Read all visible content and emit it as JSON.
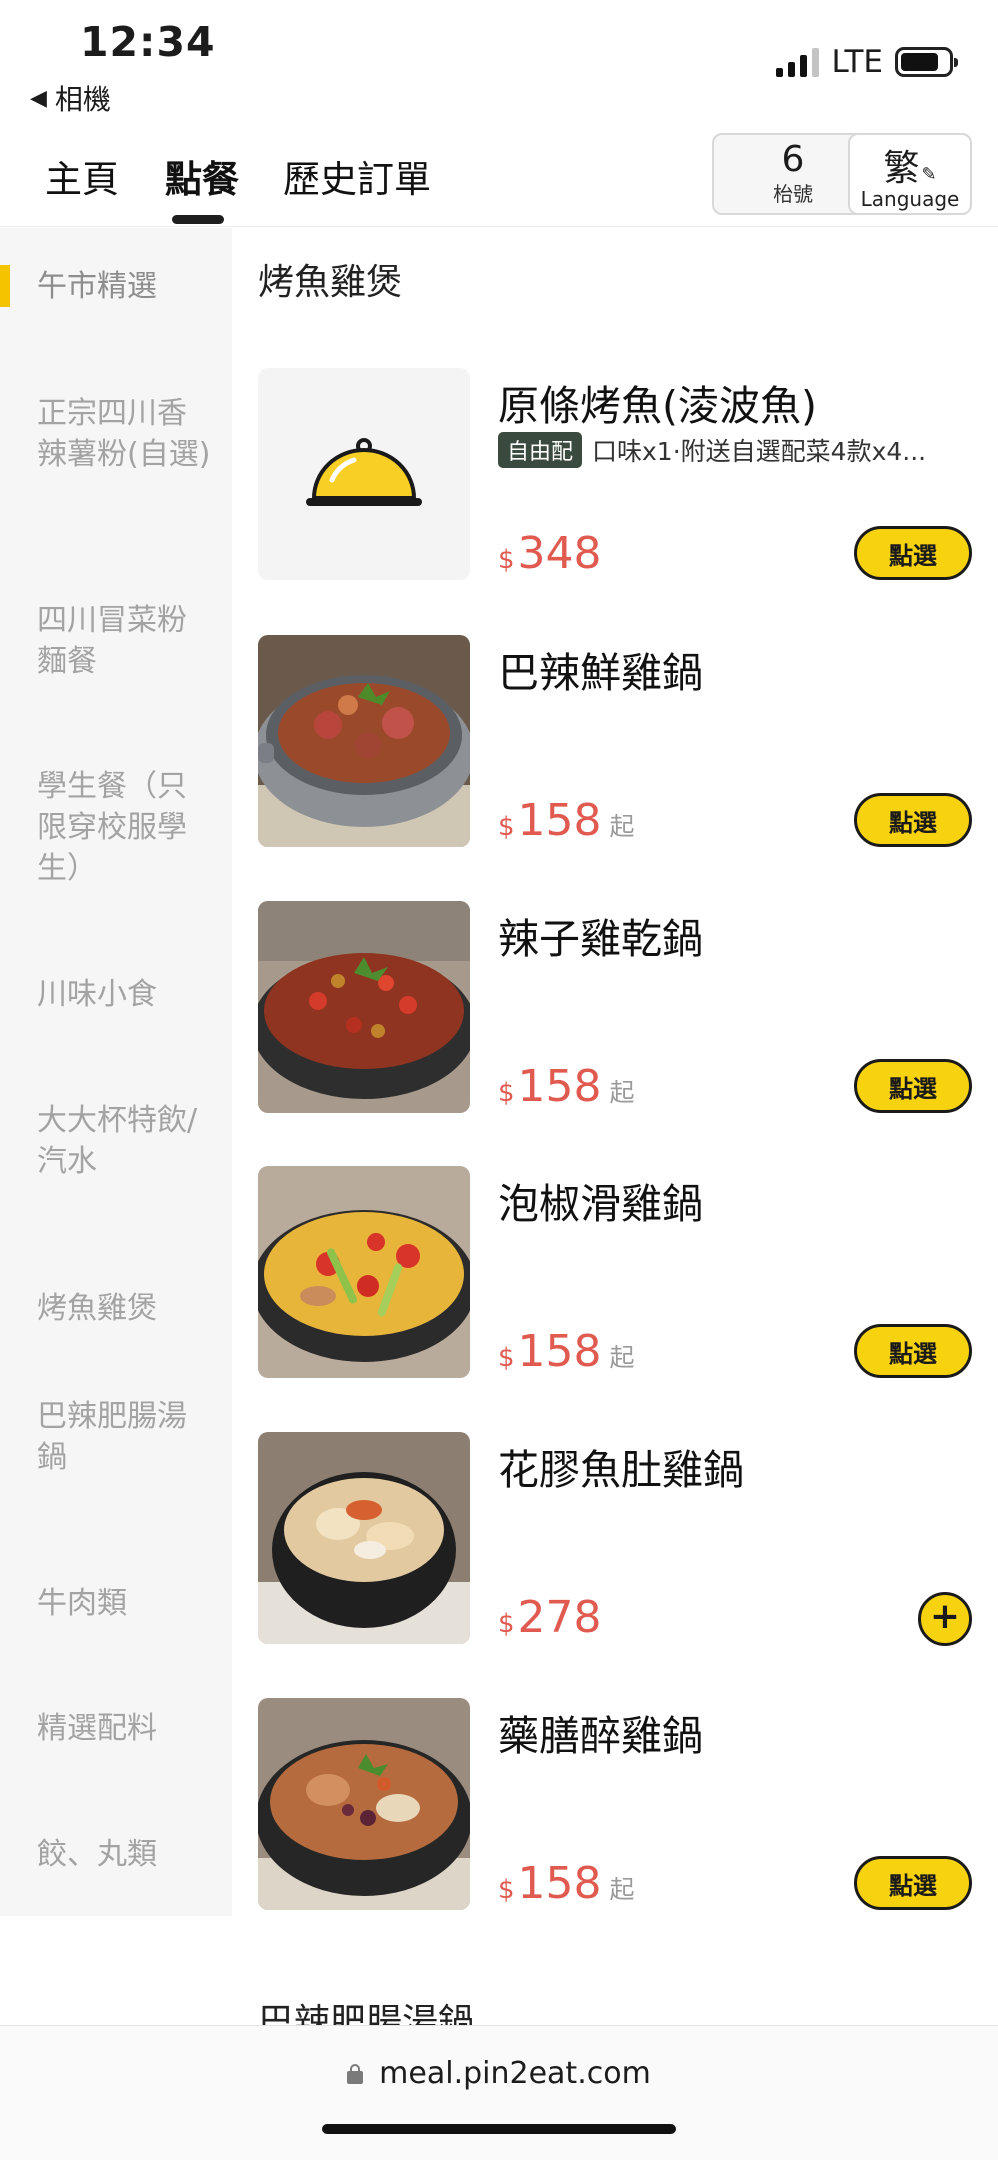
{
  "status_bar": {
    "time": "12:34",
    "back_label": "相機",
    "network": "LTE"
  },
  "nav": {
    "tabs": [
      "主頁",
      "點餐",
      "歷史訂單"
    ],
    "active_tab": "點餐",
    "table_number": "6",
    "table_label": "枱號",
    "language_char": "繁",
    "language_label": "Language"
  },
  "sidebar": {
    "items": [
      {
        "label": "午市精選"
      },
      {
        "label": "正宗四川香辣薯粉(自選)"
      },
      {
        "label": "四川冒菜粉麵餐"
      },
      {
        "label": "學生餐（只限穿校服學生）"
      },
      {
        "label": "川味小食"
      },
      {
        "label": "大大杯特飲/汽水"
      },
      {
        "label": "烤魚雞煲"
      },
      {
        "label": "巴辣肥腸湯鍋"
      },
      {
        "label": "牛肉類"
      },
      {
        "label": "精選配料"
      },
      {
        "label": "餃、丸類"
      }
    ],
    "active_index": 0
  },
  "section": {
    "title": "烤魚雞煲",
    "next_title": "巴辣肥腸湯鍋"
  },
  "menu_items": [
    {
      "name": "原條烤魚(淩波魚)",
      "tag": "自由配",
      "description": "口味x1·附送自選配菜4款x4...",
      "currency": "$",
      "price": "348",
      "suffix": "",
      "button": "點選",
      "image": "placeholder-dish-cover-icon"
    },
    {
      "name": "巴辣鮮雞鍋",
      "currency": "$",
      "price": "158",
      "suffix": "起",
      "button": "點選",
      "image": "spicy-chicken-pot-photo"
    },
    {
      "name": "辣子雞乾鍋",
      "currency": "$",
      "price": "158",
      "suffix": "起",
      "button": "點選",
      "image": "chili-chicken-dry-pot-photo"
    },
    {
      "name": "泡椒滑雞鍋",
      "currency": "$",
      "price": "158",
      "suffix": "起",
      "button": "點選",
      "image": "pickled-pepper-chicken-pot-photo"
    },
    {
      "name": "花膠魚肚雞鍋",
      "currency": "$",
      "price": "278",
      "suffix": "",
      "button": "+",
      "image": "fish-maw-chicken-pot-photo"
    },
    {
      "name": "藥膳醉雞鍋",
      "currency": "$",
      "price": "158",
      "suffix": "起",
      "button": "點選",
      "image": "herbal-drunken-chicken-pot-photo"
    }
  ],
  "browser": {
    "url": "meal.pin2eat.com"
  },
  "colors": {
    "accent_yellow": "#f7d20e",
    "price_red": "#e05a4f",
    "sidebar_bg": "#f6f6f6",
    "tag_bg": "#3b4a3e"
  }
}
